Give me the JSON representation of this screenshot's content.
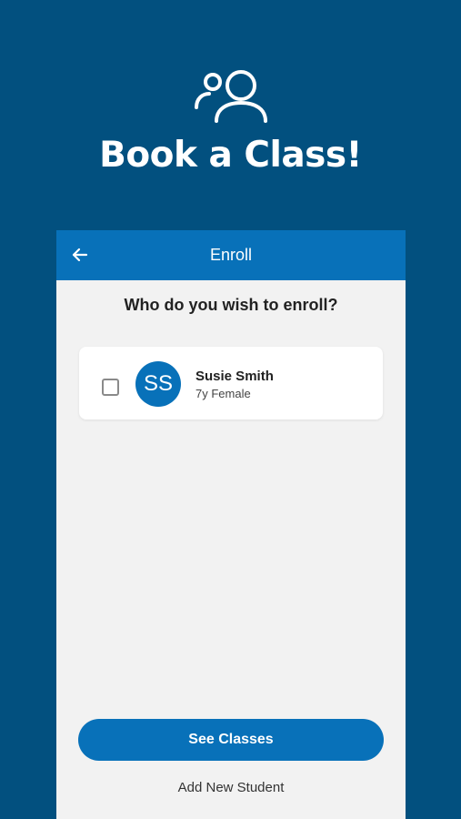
{
  "hero": {
    "icon": "people-icon",
    "title": "Book a Class!"
  },
  "appbar": {
    "back_icon": "back-arrow-icon",
    "title": "Enroll"
  },
  "enroll": {
    "question": "Who do you wish to enroll?",
    "students": [
      {
        "initials": "SS",
        "name": "Susie Smith",
        "info": "7y Female",
        "checked": false
      }
    ]
  },
  "actions": {
    "see_classes_label": "See Classes",
    "add_student_label": "Add New Student"
  },
  "colors": {
    "background": "#02507f",
    "accent": "#0871b9",
    "panel": "#f2f2f2"
  }
}
